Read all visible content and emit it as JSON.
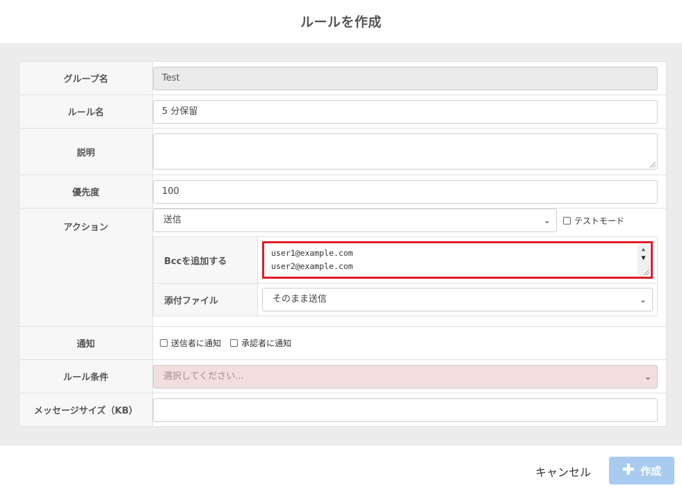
{
  "dialog": {
    "title": "ルールを作成"
  },
  "form": {
    "group_label": "グループ名",
    "group_value": "Test",
    "rule_name_label": "ルール名",
    "rule_name_value": "5 分保留",
    "description_label": "説明",
    "description_value": "",
    "priority_label": "優先度",
    "priority_value": "100",
    "action_label": "アクション",
    "action_value": "送信",
    "test_mode_label": "テストモード",
    "bcc_label": "Bccを追加する",
    "bcc_lines": [
      "user1@example.com",
      "user2@example.com"
    ],
    "attachment_label": "添付ファイル",
    "attachment_value": "そのまま送信",
    "notify_label": "通知",
    "notify_sender_label": "送信者に通知",
    "notify_approver_label": "承認者に通知",
    "rule_condition_label": "ルール条件",
    "rule_condition_placeholder": "選択してください...",
    "message_size_label": "メッセージサイズ（KB）",
    "message_size_value": ""
  },
  "footer": {
    "cancel_label": "キャンセル",
    "create_label": "作成"
  },
  "colors": {
    "highlight_border": "#e01b24",
    "create_button": "#a9cbf0",
    "rule_condition_bg": "#f2dede"
  }
}
